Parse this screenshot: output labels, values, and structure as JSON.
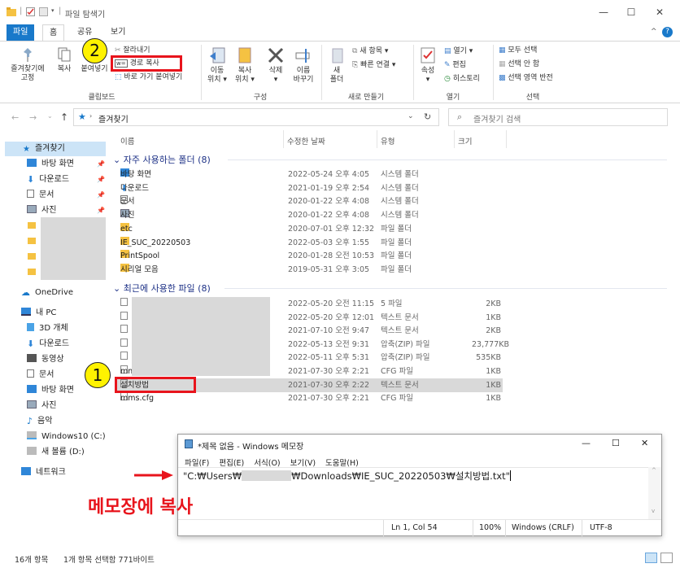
{
  "window": {
    "title": "파일 탐색기"
  },
  "ribbon_tabs": [
    "파일",
    "홈",
    "공유",
    "보기"
  ],
  "ribbon": {
    "pin_label": "즐겨찾기에\n고정",
    "copy_label": "복사",
    "paste_label": "붙여넣기",
    "cut_label": "잘라내기",
    "copy_path_label": "경로 복사",
    "paste_shortcut_label": "바로 가기 붙여넣기",
    "clipboard_group": "클립보드",
    "move_label": "이동\n위치 ▾",
    "copyto_label": "복사\n위치 ▾",
    "delete_label": "삭제\n▾",
    "rename_label": "이름\n바꾸기",
    "organize_group": "구성",
    "new_folder_label": "새\n폴더",
    "new_item_label": "새 항목 ▾",
    "easy_access_label": "빠른 연결 ▾",
    "new_group": "새로 만들기",
    "properties_label": "속성\n▾",
    "open_label": "열기 ▾",
    "edit_label": "편집",
    "history_label": "히스토리",
    "open_group": "열기",
    "select_all_label": "모두 선택",
    "select_none_label": "선택 안 함",
    "invert_label": "선택 영역 반전",
    "select_group": "선택"
  },
  "callouts": {
    "one": "1",
    "two": "2"
  },
  "address": {
    "path": "즐겨찾기",
    "search_placeholder": "즐겨찾기 검색"
  },
  "nav": {
    "quick_access": "즐겨찾기",
    "quick_items": [
      "바탕 화면",
      "다운로드",
      "문서",
      "사진"
    ],
    "onedrive": "OneDrive",
    "this_pc": "내 PC",
    "pc_items": [
      "3D 개체",
      "다운로드",
      "동영상",
      "문서",
      "바탕 화면",
      "사진",
      "음악",
      "Windows10 (C:)",
      "새 볼륨 (D:)"
    ],
    "network": "네트워크"
  },
  "columns": {
    "name": "이름",
    "date": "수정한 날짜",
    "type": "유형",
    "size": "크기"
  },
  "groups": {
    "frequent": "자주 사용하는 폴더 (8)",
    "recent": "최근에 사용한 파일 (8)"
  },
  "frequent": [
    {
      "name": "바탕 화면",
      "date": "2022-05-24 오후 4:05",
      "type": "시스템 폴더",
      "icon": "desktop-icon"
    },
    {
      "name": "다운로드",
      "date": "2021-01-19 오후 2:54",
      "type": "시스템 폴더",
      "icon": "download-icon"
    },
    {
      "name": "문서",
      "date": "2020-01-22 오후 4:08",
      "type": "시스템 폴더",
      "icon": "document-icon"
    },
    {
      "name": "사진",
      "date": "2020-01-22 오후 4:08",
      "type": "시스템 폴더",
      "icon": "picture-icon"
    },
    {
      "name": "etc",
      "date": "2020-07-01 오후 12:32",
      "type": "파일 폴더",
      "icon": "folder-icon"
    },
    {
      "name": "IE_SUC_20220503",
      "date": "2022-05-03 오후 1:55",
      "type": "파일 폴더",
      "icon": "folder-icon"
    },
    {
      "name": "PrintSpool",
      "date": "2020-01-28 오전 10:53",
      "type": "파일 폴더",
      "icon": "folder-icon"
    },
    {
      "name": "시리얼 모음",
      "date": "2019-05-31 오후 3:05",
      "type": "파일 폴더",
      "icon": "folder-icon"
    }
  ],
  "recent": [
    {
      "name": "",
      "date": "2022-05-20 오전 11:15",
      "type": "5 파일",
      "size": "2KB"
    },
    {
      "name": "",
      "date": "2022-05-20 오후 12:01",
      "type": "텍스트 문서",
      "size": "1KB"
    },
    {
      "name": "",
      "date": "2021-07-10 오전 9:47",
      "type": "텍스트 문서",
      "size": "2KB"
    },
    {
      "name": "",
      "date": "2022-05-13 오전 9:31",
      "type": "압축(ZIP) 파일",
      "size": "23,777KB"
    },
    {
      "name": "",
      "date": "2022-05-11 오후 5:31",
      "type": "압축(ZIP) 파일",
      "size": "535KB"
    },
    {
      "name": "mms.cfg",
      "date": "2021-07-30 오후 2:21",
      "type": "CFG 파일",
      "size": "1KB"
    },
    {
      "name": "설치방법",
      "date": "2021-07-30 오후 2:22",
      "type": "텍스트 문서",
      "size": "1KB"
    },
    {
      "name": "mms.cfg",
      "date": "2021-07-30 오후 2:21",
      "type": "CFG 파일",
      "size": "1KB"
    }
  ],
  "notepad": {
    "title": "*제목 없음 - Windows 메모장",
    "menu": [
      "파일(F)",
      "편집(E)",
      "서식(O)",
      "보기(V)",
      "도움말(H)"
    ],
    "text_start": "\"C:₩Users₩",
    "text_end": "₩Downloads₩IE_SUC_20220503₩설치방법.txt\"",
    "status_pos": "Ln 1, Col 54",
    "status_zoom": "100%",
    "status_eol": "Windows (CRLF)",
    "status_enc": "UTF-8"
  },
  "annotation": {
    "label": "메모장에 복사",
    "color": "#e8141c"
  },
  "statusbar": {
    "count": "16개 항목",
    "selected": "1개 항목 선택함 771바이트"
  },
  "colors": {
    "accent": "#1979ca",
    "highlight": "#e8141c",
    "callout": "#fff200",
    "group_header": "#1e3287"
  }
}
